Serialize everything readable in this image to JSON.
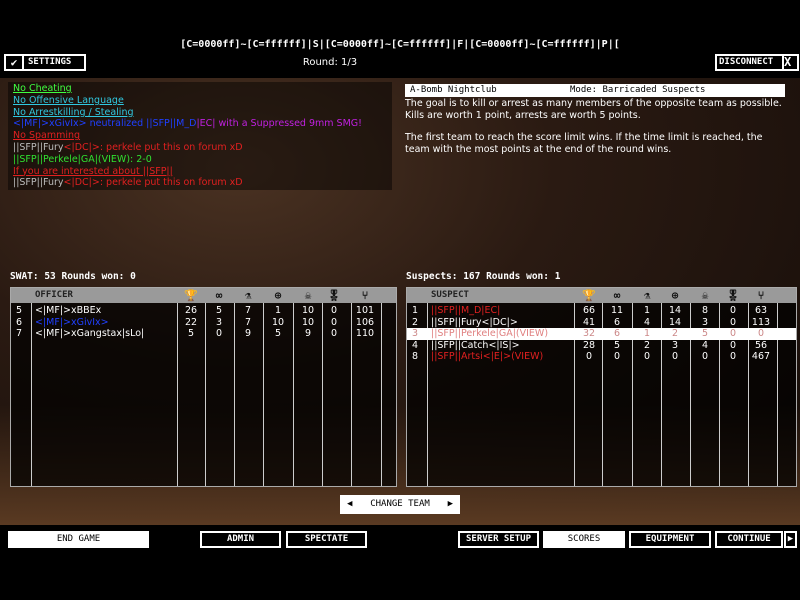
{
  "header": {
    "server_title": "[C=0000ff]~[C=ffffff]|S|[C=0000ff]~[C=ffffff]|F|[C=0000ff]~[C=ffffff]|P|[",
    "round": "Round: 1/3",
    "settings_label": "SETTINGS",
    "disconnect_label": "DISCONNECT",
    "close_glyph": "X"
  },
  "chat": [
    {
      "parts": [
        {
          "t": "No Cheating",
          "c": "lgreen",
          "u": true
        }
      ]
    },
    {
      "parts": [
        {
          "t": "No Offensive Language",
          "c": "cyan",
          "u": true
        }
      ]
    },
    {
      "parts": [
        {
          "t": "No Arrestkilling / Stealing",
          "c": "cyan",
          "u": true
        }
      ]
    },
    {
      "parts": [
        {
          "t": "<|MF|>xGivIx>",
          "c": "blue"
        },
        {
          "t": " neutralized ",
          "c": "blue"
        },
        {
          "t": "||SFP||M_D",
          "c": "blue"
        },
        {
          "t": "|EC|",
          "c": "mag"
        },
        {
          "t": " with a Suppressed 9mm SMG!",
          "c": "mag"
        }
      ]
    },
    {
      "parts": [
        {
          "t": "No Spamming",
          "c": "red",
          "u": true
        }
      ]
    },
    {
      "parts": [
        {
          "t": "||SFP||Fury",
          "c": "grey"
        },
        {
          "t": "<|DC|>",
          "c": "red"
        },
        {
          "t": ": perkele put this on forum xD",
          "c": "red"
        }
      ]
    },
    {
      "parts": [
        {
          "t": "||SFP||Perkele|GA|(VIEW)",
          "c": "green"
        },
        {
          "t": ": 2-0",
          "c": "green"
        }
      ]
    },
    {
      "parts": [
        {
          "t": "If you are interested about ||SFP||",
          "c": "red",
          "u": true
        }
      ]
    },
    {
      "parts": [
        {
          "t": "||SFP||Fury",
          "c": "grey"
        },
        {
          "t": "<|DC|>",
          "c": "red"
        },
        {
          "t": ": perkele put this on forum xD",
          "c": "red"
        }
      ]
    }
  ],
  "info": {
    "map": "A-Bomb Nightclub",
    "mode": "Mode: Barricaded Suspects",
    "para1": "The goal is to kill or arrest as many members of the opposite team as possible.  Kills are worth 1 point, arrests are worth 5 points.",
    "para2": "The first team to reach the score limit wins.  If the time limit is reached, the team with the most points at the end of the round wins."
  },
  "column_icons": [
    "trophy-icon",
    "handcuffs-icon",
    "microscope-icon",
    "crosshair-icon",
    "skull-icon",
    "medal-icon",
    "network-icon"
  ],
  "swat": {
    "label": "SWAT: 53    Rounds won: 0",
    "header": "OFFICER",
    "rows": [
      {
        "n": "5",
        "name": "<|MF|>xBBEx",
        "v": [
          "26",
          "5",
          "7",
          "1",
          "10",
          "0",
          "101"
        ]
      },
      {
        "n": "6",
        "name": "<|MF|>xGivIx>",
        "v": [
          "22",
          "3",
          "7",
          "10",
          "10",
          "0",
          "106"
        ],
        "color": "blue"
      },
      {
        "n": "7",
        "name": "<|MF|>xGangstax|sLo|",
        "v": [
          "5",
          "0",
          "9",
          "5",
          "9",
          "0",
          "110"
        ]
      }
    ]
  },
  "suspects": {
    "label": "Suspects: 167    Rounds won: 1",
    "header": "SUSPECT",
    "rows": [
      {
        "n": "1",
        "name": "||SFP||M_D|EC|",
        "v": [
          "66",
          "11",
          "1",
          "14",
          "8",
          "0",
          "63"
        ],
        "color": "red"
      },
      {
        "n": "2",
        "name": "||SFP||Fury<|DC|>",
        "v": [
          "41",
          "6",
          "4",
          "14",
          "3",
          "0",
          "113"
        ]
      },
      {
        "n": "3",
        "name": "||SFP||Perkele|GA|(VIEW)",
        "v": [
          "32",
          "6",
          "1",
          "2",
          "5",
          "0",
          "0"
        ],
        "selected": true
      },
      {
        "n": "4",
        "name": "||SFP||Catch<|IS|>",
        "v": [
          "28",
          "5",
          "2",
          "3",
          "4",
          "0",
          "56"
        ]
      },
      {
        "n": "8",
        "name": "||SFP||Artsi<|E|>(VIEW)",
        "v": [
          "0",
          "0",
          "0",
          "0",
          "0",
          "0",
          "467"
        ],
        "color": "red"
      }
    ]
  },
  "change_team": "CHANGE TEAM",
  "bottom": {
    "end_game": "END GAME",
    "admin": "ADMIN",
    "spectate": "SPECTATE",
    "server_setup": "SERVER SETUP",
    "scores": "SCORES",
    "equipment": "EQUIPMENT",
    "continue": "CONTINUE"
  }
}
